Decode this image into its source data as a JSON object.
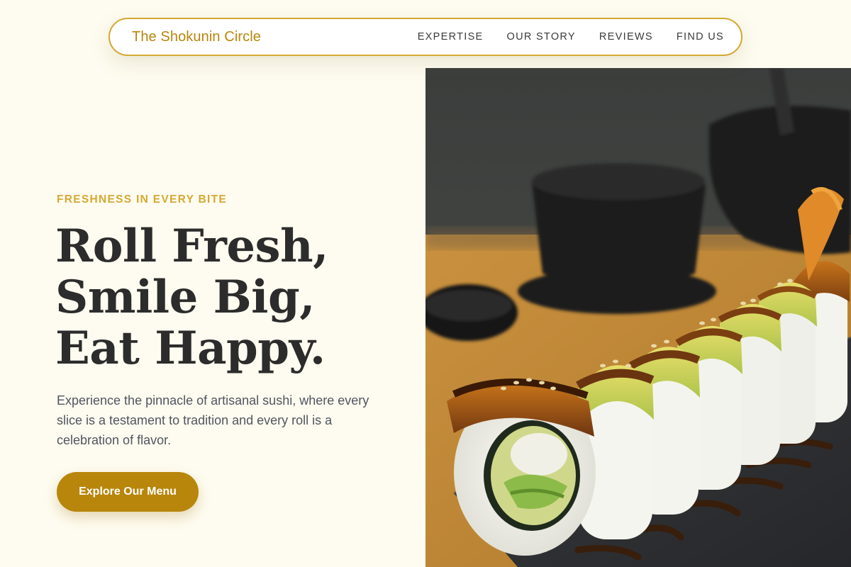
{
  "nav": {
    "brand": "The Shokunin Circle",
    "links": [
      "EXPERTISE",
      "OUR STORY",
      "REVIEWS",
      "FIND US"
    ]
  },
  "hero": {
    "eyebrow": "FRESHNESS IN EVERY BITE",
    "headline": [
      "Roll Fresh,",
      "Smile Big,",
      "Eat Happy."
    ],
    "lead": "Experience the pinnacle of artisanal sushi, where every slice is a testament to tradition and every roll is a celebration of flavor.",
    "cta_label": "Explore Our Menu"
  },
  "colors": {
    "background": "#fefcf0",
    "accent": "#b8860b",
    "eyebrow": "#d4a932",
    "headline": "#2c2c2c",
    "body_text": "#505560"
  }
}
